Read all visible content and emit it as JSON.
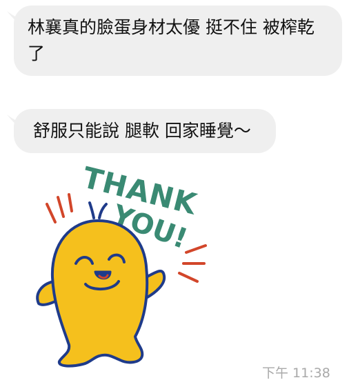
{
  "messages": [
    {
      "text": "林襄真的臉蛋身材太優 挺不住 被榨乾了"
    },
    {
      "text": "舒服只能說 腿軟 回家睡覺～"
    }
  ],
  "sticker": {
    "text_line1": "THANK",
    "text_line2": "YOU!",
    "text_color": "#3a8a73",
    "body_color": "#f5c01d",
    "outline_color": "#1f3b8a",
    "accent_color": "#d2462a"
  },
  "timestamp": "下午 11:38",
  "colors": {
    "bubble": "#efefef",
    "timestamp": "#a9a9a9"
  }
}
